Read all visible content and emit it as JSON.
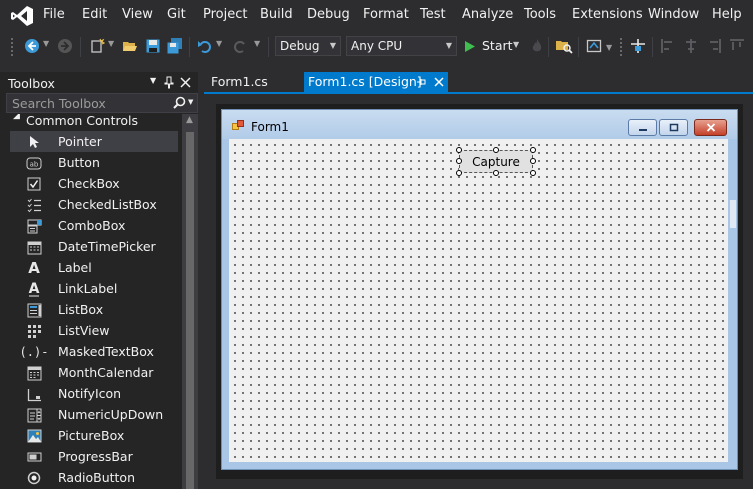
{
  "menu": [
    "File",
    "Edit",
    "View",
    "Git",
    "Project",
    "Build",
    "Debug",
    "Format",
    "Test",
    "Analyze",
    "Tools",
    "Extensions",
    "Window",
    "Help"
  ],
  "toolbar": {
    "config": "Debug",
    "platform": "Any CPU",
    "start_label": "Start"
  },
  "toolbox": {
    "title": "Toolbox",
    "search_placeholder": "Search Toolbox",
    "group": "Common Controls",
    "items": [
      {
        "label": "Pointer",
        "icon": "pointer-icon"
      },
      {
        "label": "Button",
        "icon": "button-icon"
      },
      {
        "label": "CheckBox",
        "icon": "checkbox-icon"
      },
      {
        "label": "CheckedListBox",
        "icon": "checkedlistbox-icon"
      },
      {
        "label": "ComboBox",
        "icon": "combobox-icon"
      },
      {
        "label": "DateTimePicker",
        "icon": "datetimepicker-icon"
      },
      {
        "label": "Label",
        "icon": "label-icon"
      },
      {
        "label": "LinkLabel",
        "icon": "linklabel-icon"
      },
      {
        "label": "ListBox",
        "icon": "listbox-icon"
      },
      {
        "label": "ListView",
        "icon": "listview-icon"
      },
      {
        "label": "MaskedTextBox",
        "icon": "maskedtextbox-icon"
      },
      {
        "label": "MonthCalendar",
        "icon": "monthcalendar-icon"
      },
      {
        "label": "NotifyIcon",
        "icon": "notifyicon-icon"
      },
      {
        "label": "NumericUpDown",
        "icon": "numericupdown-icon"
      },
      {
        "label": "PictureBox",
        "icon": "picturebox-icon"
      },
      {
        "label": "ProgressBar",
        "icon": "progressbar-icon"
      },
      {
        "label": "RadioButton",
        "icon": "radiobutton-icon"
      }
    ]
  },
  "tabs": {
    "inactive": "Form1.cs",
    "active": "Form1.cs [Design]"
  },
  "form": {
    "title": "Form1",
    "button_text": "Capture"
  },
  "colors": {
    "accent": "#007acc",
    "background": "#2d2d30",
    "panel": "#252526",
    "selected_tool": "#3f3f46"
  }
}
